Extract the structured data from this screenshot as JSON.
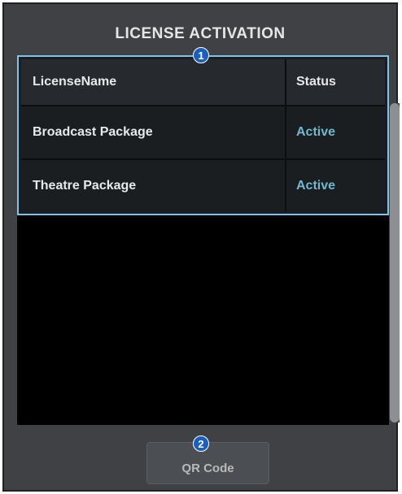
{
  "window": {
    "title": "LICENSE ACTIVATION"
  },
  "table": {
    "headers": {
      "name": "LicenseName",
      "status": "Status"
    },
    "rows": [
      {
        "name": "Broadcast Package",
        "status": "Active"
      },
      {
        "name": "Theatre Package",
        "status": "Active"
      }
    ]
  },
  "callouts": {
    "one": "1",
    "two": "2"
  },
  "buttons": {
    "qr_code": "QR Code"
  },
  "colors": {
    "panel_bg": "#3f4144",
    "selection_border": "#7fc3e8",
    "active_status": "#73b7cc",
    "callout_fill": "#1a5fbf"
  }
}
